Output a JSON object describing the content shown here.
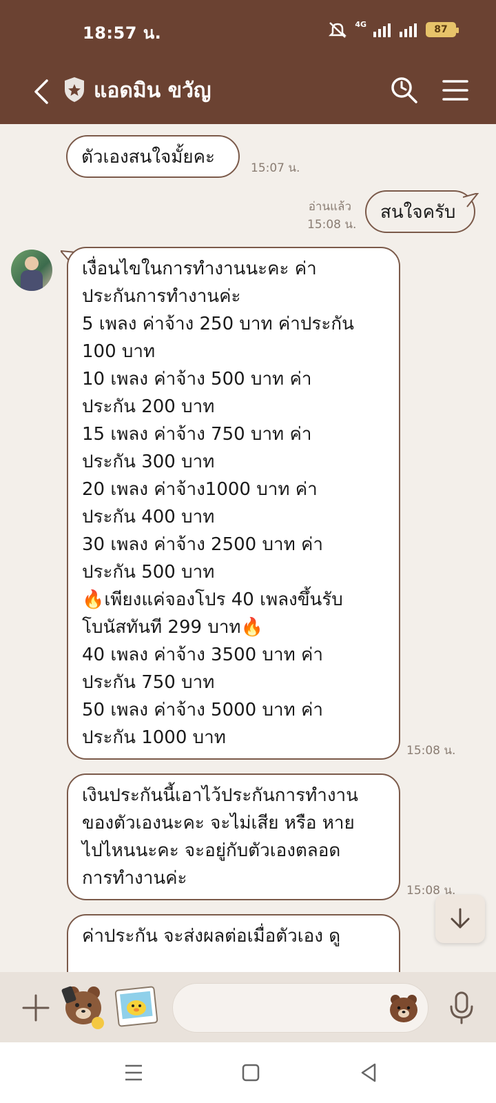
{
  "status": {
    "time": "18:57 น.",
    "network": "4G",
    "battery": "87"
  },
  "header": {
    "title": "แอดมิน ขวัญ"
  },
  "messages": [
    {
      "text": "ตัวเองสนใจมั้ยคะ",
      "time": "15:07 น."
    },
    {
      "text": "สนใจครับ",
      "read": "อ่านแล้ว",
      "time": "15:08 น."
    },
    {
      "text": "เงื่อนไขในการทำงานนะคะ  ค่า\nประกันการทำงานค่ะ\n5 เพลง ค่าจ้าง 250 บาท ค่าประกัน\n100 บาท\n10 เพลง  ค่าจ้าง 500 บาท ค่า\nประกัน 200 บาท\n15 เพลง  ค่าจ้าง  750 บาท ค่า\nประกัน 300 บาท\n20 เพลง  ค่าจ้าง1000 บาท ค่า\nประกัน 400 บาท\n30 เพลง  ค่าจ้าง 2500 บาท ค่า\nประกัน 500 บาท\n🔥เพียงแค่จองโปร 40 เพลงขึ้นรับ\nโบนัสทันที 299 บาท🔥\n40 เพลง  ค่าจ้าง 3500 บาท ค่า\nประกัน 750 บาท\n50 เพลง  ค่าจ้าง 5000 บาท ค่า\nประกัน 1000 บาท",
      "time": "15:08 น."
    },
    {
      "text": "เงินประกันนี้เอาไว้ประกันการทำงาน\nของตัวเองนะคะ จะไม่เสีย หรือ หาย\nไปไหนนะคะ จะอยู่กับตัวเองตลอด\nการทำงานค่ะ",
      "time": "15:08 น."
    },
    {
      "text": "ค่าประกัน จะส่งผลต่อเมื่อตัวเอง ดู"
    }
  ],
  "input": {
    "placeholder": ""
  },
  "colors": {
    "header": "#6b4232",
    "chat_background": "#f3efea",
    "bubble_border": "#7b5a4a",
    "battery": "#e7c36a"
  },
  "icons": [
    "back-arrow-icon",
    "shield-icon",
    "search-icon",
    "menu-icon",
    "plus-icon",
    "bear-sticker-icon",
    "photo-sticker-icon",
    "emoji-icon",
    "mic-icon",
    "scroll-down-icon",
    "recent-apps-icon",
    "home-icon",
    "back-icon"
  ]
}
